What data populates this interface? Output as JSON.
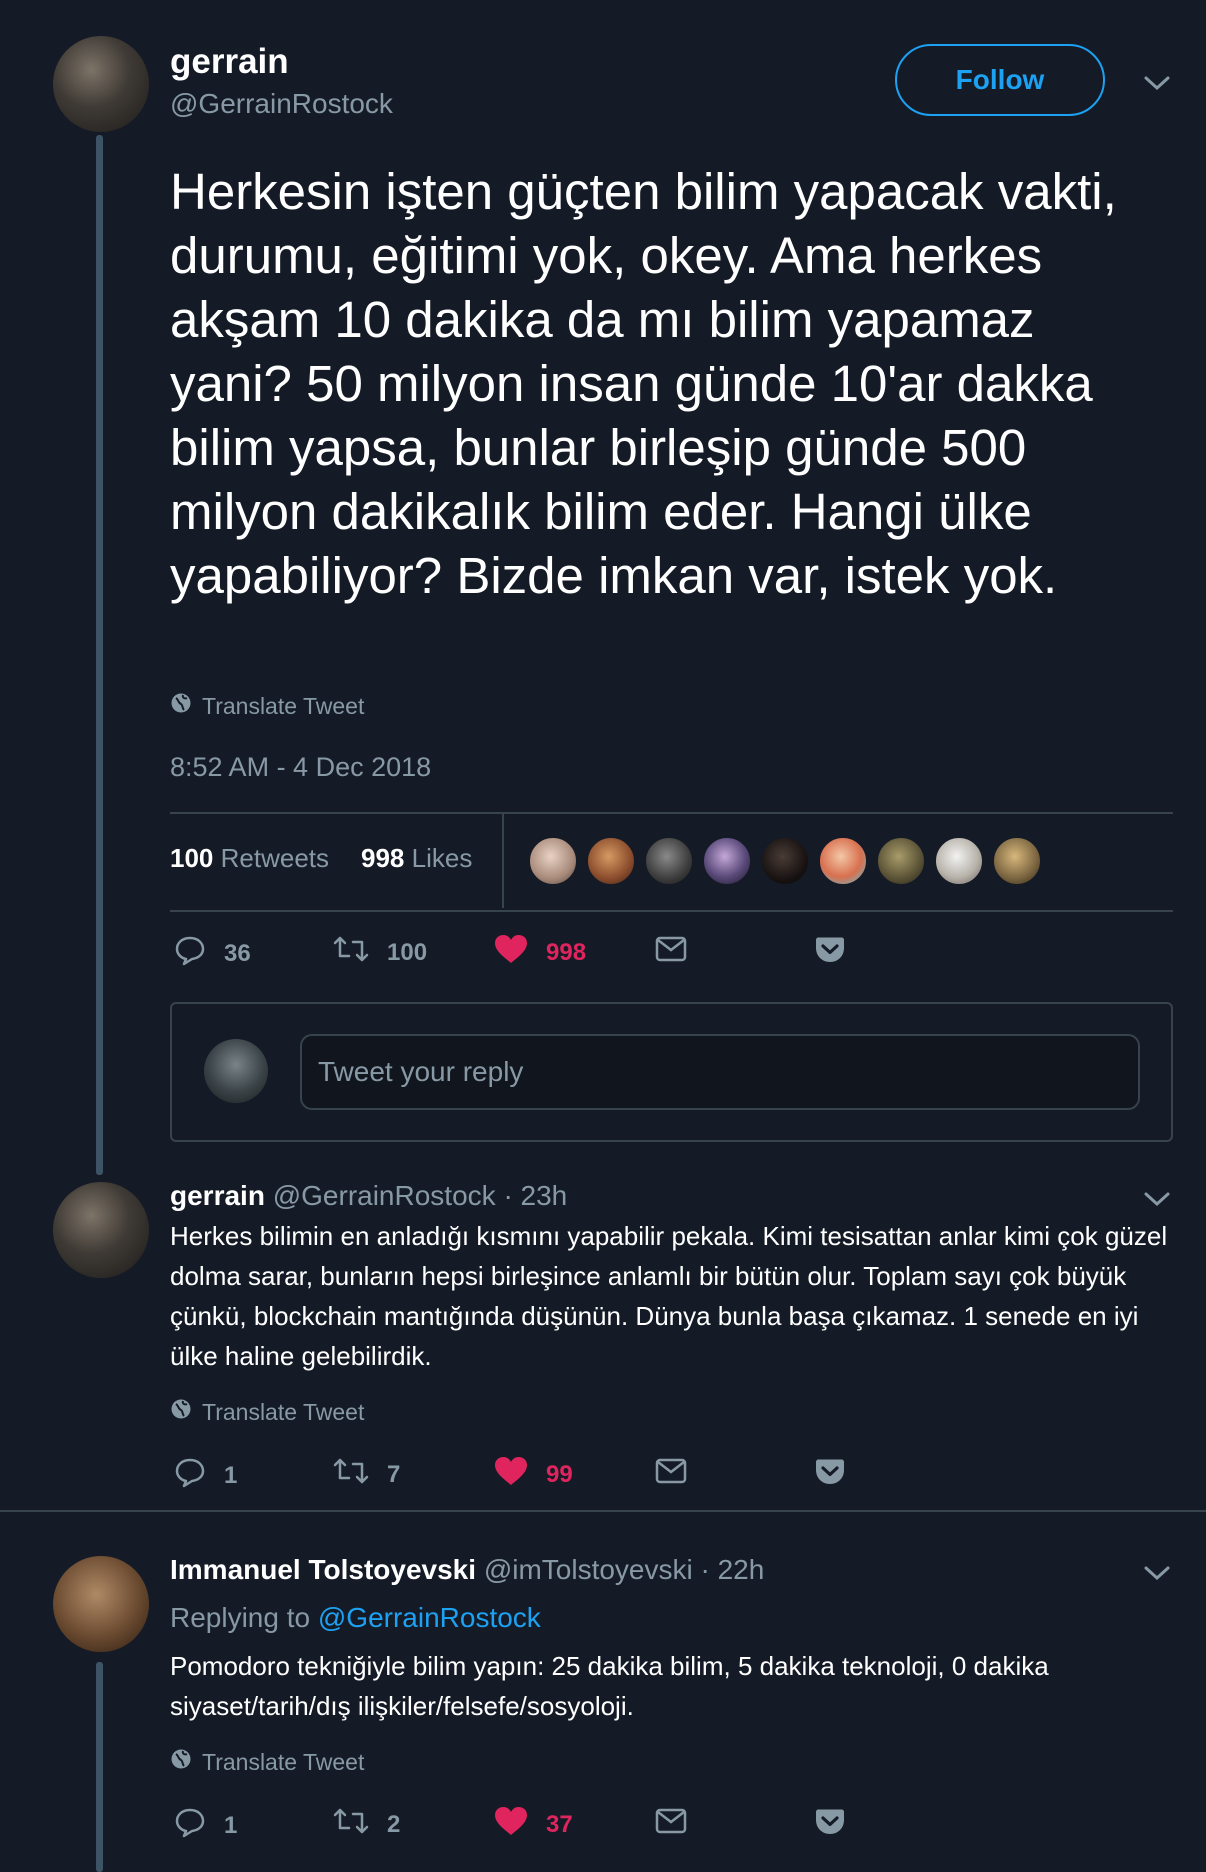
{
  "main_tweet": {
    "name": "gerrain",
    "handle": "@GerrainRostock",
    "follow_label": "Follow",
    "text": "Herkesin işten güçten bilim yapacak vakti, durumu, eğitimi yok, okey. Ama herkes akşam 10 dakika da mı bilim yapamaz yani? 50 milyon insan günde 10'ar dakka bilim yapsa, bunlar birleşip günde 500 milyon dakikalık bilim eder. Hangi ülke yapabiliyor? Bizde imkan var, istek yok.",
    "translate_label": "Translate Tweet",
    "timestamp": "8:52 AM - 4 Dec 2018",
    "retweets_count": "100",
    "retweets_label": "Retweets",
    "likes_count": "998",
    "likes_label": "Likes",
    "actions": {
      "replies": "36",
      "retweets": "100",
      "likes": "998"
    }
  },
  "reply_composer": {
    "placeholder": "Tweet your reply"
  },
  "replies": [
    {
      "name": "gerrain",
      "handle": "@GerrainRostock",
      "time": "· 23h",
      "text": "Herkes bilimin en anladığı kısmını yapabilir pekala. Kimi tesisattan anlar kimi çok güzel dolma sarar, bunların hepsi birleşince anlamlı bir bütün olur. Toplam sayı çok büyük çünkü, blockchain mantığında düşünün. Dünya bunla başa çıkamaz. 1 senede en iyi ülke haline gelebilirdik.",
      "translate_label": "Translate Tweet",
      "actions": {
        "replies": "1",
        "retweets": "7",
        "likes": "99"
      }
    },
    {
      "name": "Immanuel Tolstoyevski",
      "handle": "@imTolstoyevski",
      "time": "· 22h",
      "replying_prefix": "Replying to",
      "replying_to": "@GerrainRostock",
      "text": "Pomodoro tekniğiyle bilim yapın: 25 dakika bilim, 5 dakika teknoloji, 0 dakika siyaset/tarih/dış ilişkiler/felsefe/sosyoloji.",
      "translate_label": "Translate Tweet",
      "actions": {
        "replies": "1",
        "retweets": "2",
        "likes": "37"
      }
    }
  ],
  "colors": {
    "background": "#151b26",
    "accent": "#1da1f2",
    "like": "#e0245e",
    "muted": "#8899a6",
    "border": "#38444d"
  }
}
